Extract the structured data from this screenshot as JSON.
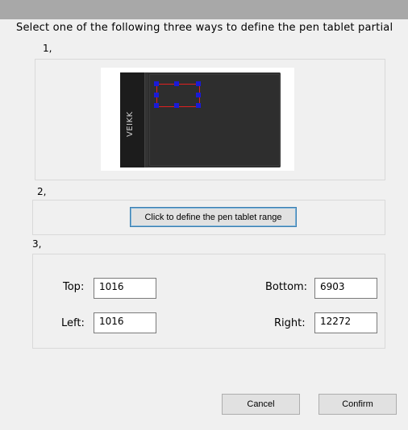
{
  "instruction": "Select one of the following three ways to define the pen tablet partial",
  "section1": {
    "number": "1,"
  },
  "tablet": {
    "brand": "VEIKK"
  },
  "section2": {
    "number": "2,",
    "button_label": "Click to define the pen tablet range"
  },
  "section3": {
    "number": "3,",
    "top_label": "Top:",
    "top_value": "1016",
    "bottom_label": "Bottom:",
    "bottom_value": "6903",
    "left_label": "Left:",
    "left_value": "1016",
    "right_label": "Right:",
    "right_value": "12272"
  },
  "footer": {
    "cancel_label": "Cancel",
    "confirm_label": "Confirm"
  },
  "colors": {
    "selection_border": "#e02020",
    "handle": "#1b1bd6",
    "focused_button_border": "#3c7fb1"
  }
}
